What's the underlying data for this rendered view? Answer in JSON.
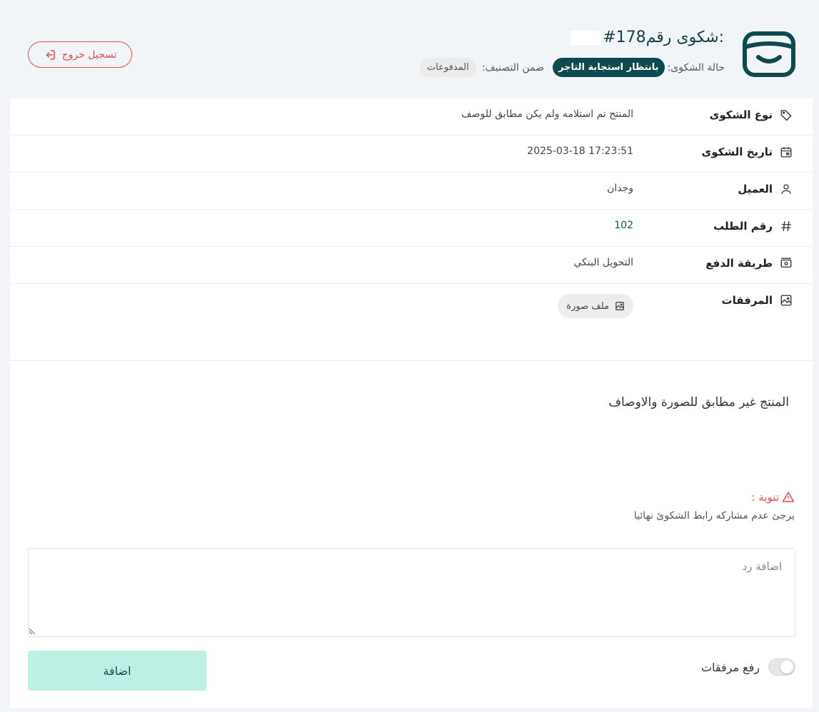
{
  "header": {
    "title_text": "شكوى رقم:",
    "title_number": "#178",
    "status_label": "حالة الشكوى:",
    "status_value": "بانتظار استجابة التاجر",
    "category_label": "ضمن التصنيف:",
    "category_value": "المدفوعات",
    "logout_label": "تسجيل خروج"
  },
  "details": [
    {
      "label": "نوع الشكوى",
      "value": "المنتج تم استلامه ولم  يكن مطابق للوصف",
      "icon": "tag-icon"
    },
    {
      "label": "تاريخ الشكوى",
      "value": "2025-03-18 17:23:51",
      "icon": "calendar-icon"
    },
    {
      "label": "العميل",
      "value": "وجدان",
      "icon": "user-icon"
    },
    {
      "label": "رقم الطلب",
      "value": "102",
      "icon": "hash-icon"
    },
    {
      "label": "طريقة الدفع",
      "value": "التحويل البنكي",
      "icon": "money-icon"
    },
    {
      "label": "المرفقات",
      "value": "ملف صورة",
      "icon": "image-icon"
    }
  ],
  "description": "المنتج غير مطابق للصورة والاوصاف",
  "notice": {
    "title": "تنوية :",
    "text": "يرجئ عدم مشاركه رابط الشكوئ نهائيا"
  },
  "reply": {
    "placeholder": "اضافة رد",
    "submit_label": "اضافة",
    "upload_label": "رفع مرفقات",
    "upload_enabled": false
  },
  "colors": {
    "brand": "#0d4a4f",
    "danger": "#e54b4b",
    "submit_bg": "#bdf0e4"
  }
}
